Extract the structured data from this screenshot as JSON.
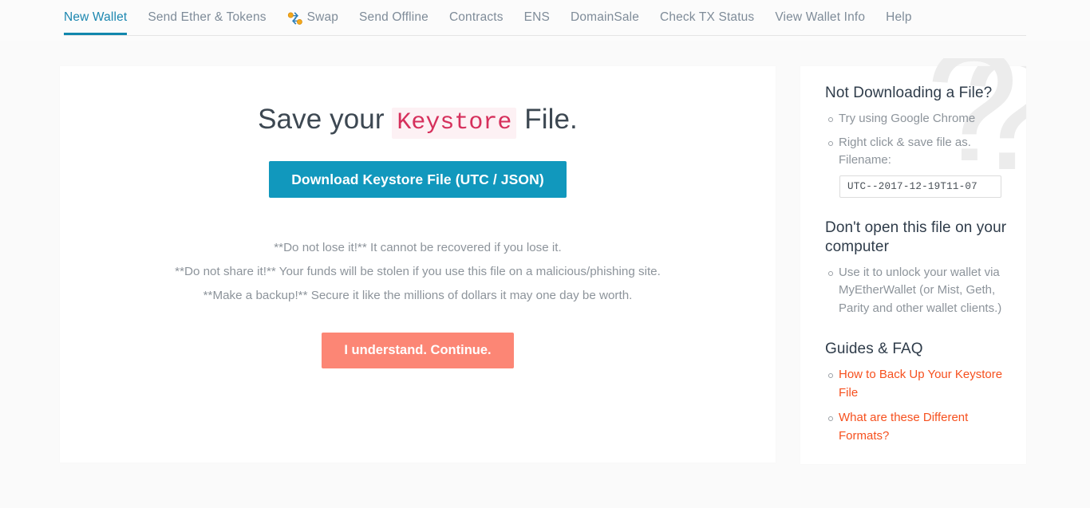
{
  "nav": {
    "items": [
      {
        "label": "New Wallet",
        "name": "tab-new-wallet",
        "active": true,
        "icon": null
      },
      {
        "label": "Send Ether & Tokens",
        "name": "tab-send-ether-tokens",
        "active": false,
        "icon": null
      },
      {
        "label": "Swap",
        "name": "tab-swap",
        "active": false,
        "icon": "swap-icon"
      },
      {
        "label": "Send Offline",
        "name": "tab-send-offline",
        "active": false,
        "icon": null
      },
      {
        "label": "Contracts",
        "name": "tab-contracts",
        "active": false,
        "icon": null
      },
      {
        "label": "ENS",
        "name": "tab-ens",
        "active": false,
        "icon": null
      },
      {
        "label": "DomainSale",
        "name": "tab-domainsale",
        "active": false,
        "icon": null
      },
      {
        "label": "Check TX Status",
        "name": "tab-check-tx-status",
        "active": false,
        "icon": null
      },
      {
        "label": "View Wallet Info",
        "name": "tab-view-wallet-info",
        "active": false,
        "icon": null
      },
      {
        "label": "Help",
        "name": "tab-help",
        "active": false,
        "icon": null
      }
    ]
  },
  "main": {
    "heading_before": "Save your ",
    "heading_code": "Keystore",
    "heading_after": " File.",
    "download_button": "Download Keystore File (UTC / JSON)",
    "warnings": [
      "**Do not lose it!** It cannot be recovered if you lose it.",
      "**Do not share it!** Your funds will be stolen if you use this file on a malicious/phishing site.",
      "**Make a backup!** Secure it like the millions of dollars it may one day be worth."
    ],
    "continue_button": "I understand. Continue."
  },
  "sidebar": {
    "watermark": "?",
    "section1": {
      "heading": "Not Downloading a File?",
      "items": [
        "Try using Google Chrome",
        "Right click & save file as. Filename:"
      ],
      "filename_value": "UTC--2017-12-19T11-07",
      "filename_placeholder": "UTC--2017-12-19T11-07"
    },
    "section2": {
      "heading": "Don't open this file on your computer",
      "items": [
        "Use it to unlock your wallet via MyEtherWallet (or Mist, Geth, Parity and other wallet clients.)"
      ]
    },
    "section3": {
      "heading": "Guides & FAQ",
      "links": [
        "How to Back Up Your Keystore File",
        "What are these Different Formats?"
      ]
    }
  },
  "colors": {
    "accent_blue": "#1198bd",
    "active_tab": "#1187ad",
    "continue_coral": "#fc8675",
    "link_orange": "#f6501e",
    "code_red": "#d6305c",
    "page_bg": "#fafafa"
  }
}
